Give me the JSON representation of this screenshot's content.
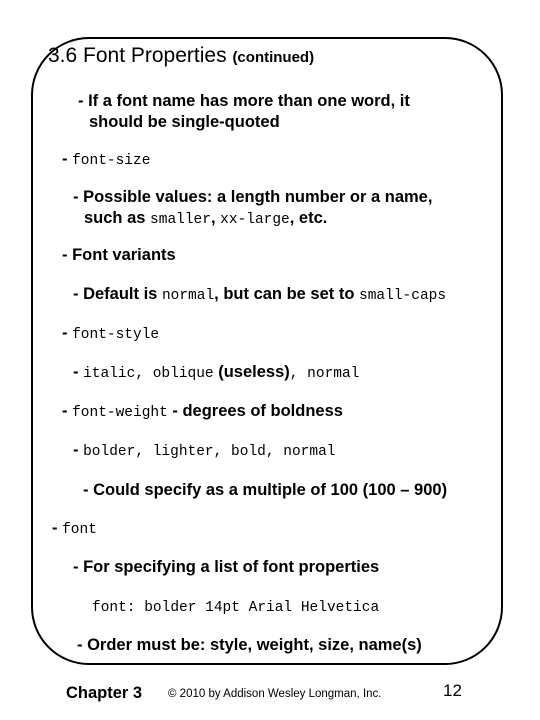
{
  "slide": {
    "title": "3.6 Font Properties",
    "title_suffix": "(continued)",
    "items": [
      {
        "dash": "-",
        "text1": "If a font name has more than one word, it",
        "text2": "should be single-quoted"
      },
      {
        "dash": "-",
        "code": "font-size"
      },
      {
        "dash": "-",
        "text1": "Possible values: a length number or a name,",
        "prefix": "such as ",
        "code1": "smaller",
        "sep1": ", ",
        "code2": "xx-large",
        "suffix": ", etc."
      },
      {
        "dash": "-",
        "text": "Font variants"
      },
      {
        "dash": "-",
        "prefix": "Default is ",
        "code1": "normal",
        "mid": ", but can be set to ",
        "code2": "small-caps"
      },
      {
        "dash": "-",
        "code": "font-style"
      },
      {
        "dash": "-",
        "code1": "italic",
        "sep1": ", ",
        "code2": "oblique",
        "mid": " (useless)",
        "sep2": ", ",
        "code3": "normal"
      },
      {
        "dash": "-",
        "code": "font-weight",
        "text": " - degrees of boldness"
      },
      {
        "dash": "-",
        "code1": "bolder",
        "code2": "lighter",
        "code3": "bold",
        "code4": "normal",
        "sep": ", "
      },
      {
        "dash": "-",
        "text": "Could specify as a multiple of 100 (100 – 900)"
      },
      {
        "dash": "-",
        "code": "font"
      },
      {
        "dash": "-",
        "text": "For specifying a list of font properties"
      },
      {
        "code": "font: bolder 14pt Arial Helvetica"
      },
      {
        "dash": "-",
        "text": "Order must be: style, weight, size, name(s)"
      }
    ]
  },
  "footer": {
    "chapter": "Chapter 3",
    "copyright": "© 2010 by Addison Wesley Longman, Inc.",
    "page_number": "12"
  }
}
